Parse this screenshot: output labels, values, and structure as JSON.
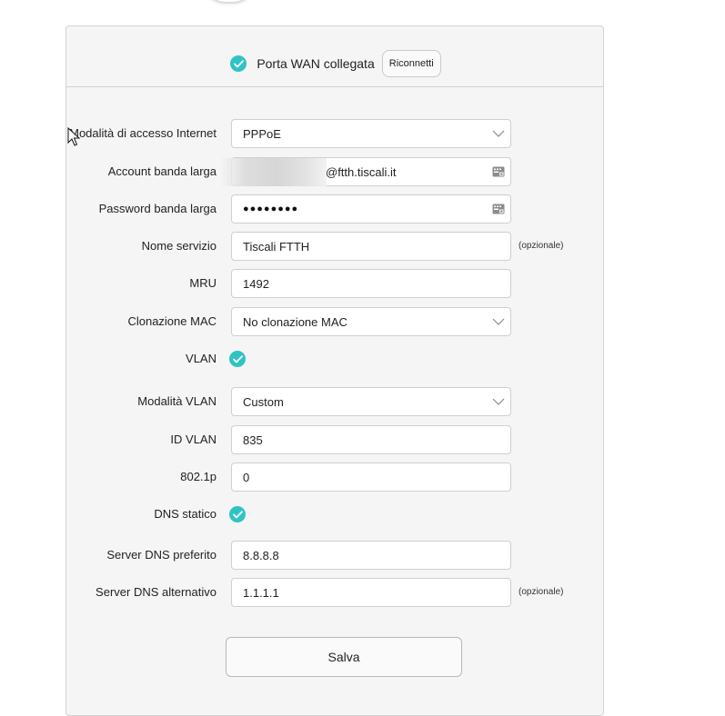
{
  "status": {
    "text": "Porta WAN collegata",
    "reconnect_label": "Riconnetti"
  },
  "form": {
    "access_mode": {
      "label": "Modalità di accesso Internet",
      "value": "PPPoE"
    },
    "account": {
      "label": "Account banda larga",
      "value": "@ftth.tiscali.it"
    },
    "password": {
      "label": "Password banda larga",
      "value": "●●●●●●●●"
    },
    "service_name": {
      "label": "Nome servizio",
      "value": "Tiscali FTTH",
      "hint": "(opzionale)"
    },
    "mru": {
      "label": "MRU",
      "value": "1492"
    },
    "mac_clone": {
      "label": "Clonazione MAC",
      "value": "No clonazione MAC"
    },
    "vlan": {
      "label": "VLAN",
      "checked": true
    },
    "vlan_mode": {
      "label": "Modalità VLAN",
      "value": "Custom"
    },
    "vlan_id": {
      "label": "ID VLAN",
      "value": "835"
    },
    "dot1p": {
      "label": "802.1p",
      "value": "0"
    },
    "static_dns": {
      "label": "DNS statico",
      "checked": true
    },
    "dns_primary": {
      "label": "Server DNS preferito",
      "value": "8.8.8.8"
    },
    "dns_secondary": {
      "label": "Server DNS alternativo",
      "value": "1.1.1.1",
      "hint": "(opzionale)"
    }
  },
  "save_label": "Salva",
  "colors": {
    "accent": "#31c3c3",
    "panel": "#f5f5f5",
    "border": "#cfcfcf"
  }
}
